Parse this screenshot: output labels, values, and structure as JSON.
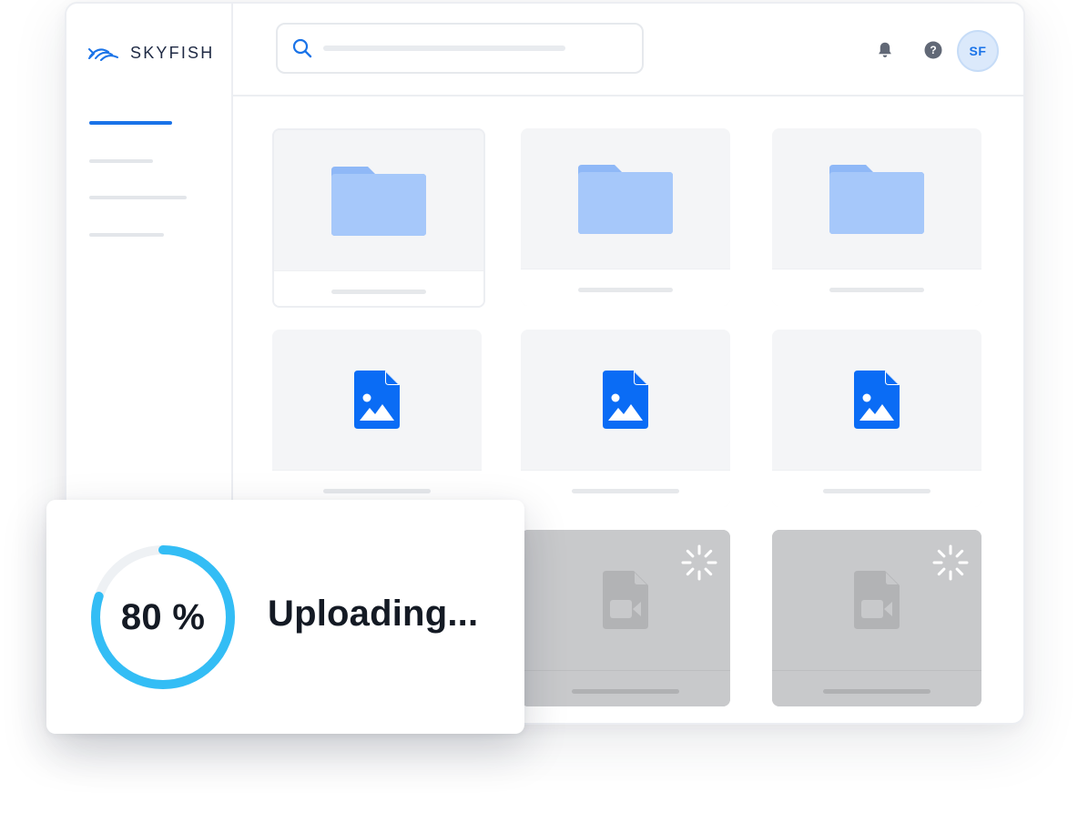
{
  "app": {
    "brand_name": "SKYFISH",
    "brand_color": "#1a73e8"
  },
  "sidebar": {
    "items": [
      {
        "name": "nav-item-1",
        "active": true
      },
      {
        "name": "nav-item-2",
        "active": false
      },
      {
        "name": "nav-item-3",
        "active": false
      },
      {
        "name": "nav-item-4",
        "active": false
      }
    ]
  },
  "header": {
    "search": {
      "value": "",
      "icon": "search-icon"
    },
    "icons": [
      "bell-icon",
      "help-icon"
    ],
    "avatar_initials": "SF"
  },
  "grid": {
    "items": [
      {
        "type": "folder",
        "icon": "folder-icon",
        "state": "ready"
      },
      {
        "type": "folder",
        "icon": "folder-icon",
        "state": "ready"
      },
      {
        "type": "folder",
        "icon": "folder-icon",
        "state": "ready"
      },
      {
        "type": "image-file",
        "icon": "image-file-icon",
        "state": "ready"
      },
      {
        "type": "image-file",
        "icon": "image-file-icon",
        "state": "ready"
      },
      {
        "type": "image-file",
        "icon": "image-file-icon",
        "state": "ready"
      },
      {
        "type": "video-file",
        "icon": "video-file-icon",
        "state": "hidden-behind-panel"
      },
      {
        "type": "video-file",
        "icon": "video-file-icon",
        "state": "uploading"
      },
      {
        "type": "video-file",
        "icon": "video-file-icon",
        "state": "uploading"
      }
    ]
  },
  "upload": {
    "progress": 0.8,
    "progress_label": "80 %",
    "status_label": "Uploading...",
    "ring_color": "#33bdf5",
    "track_color": "#eef1f4"
  }
}
